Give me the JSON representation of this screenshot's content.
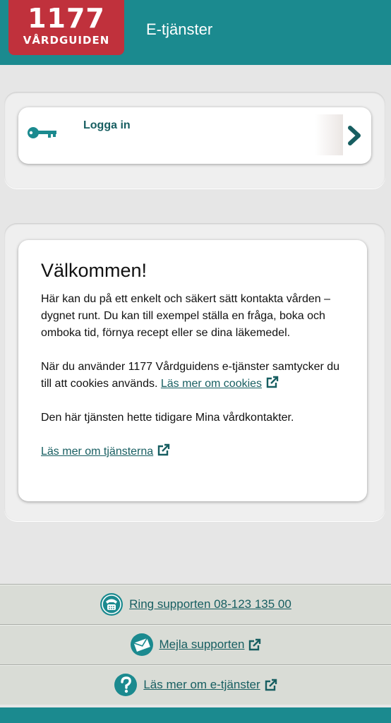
{
  "header": {
    "logo_number": "1177",
    "logo_name": "VÅRDGUIDEN",
    "title": "E-tjänster"
  },
  "login": {
    "label": "Logga in",
    "icon": "key-icon",
    "arrow_icon": "chevron-right-icon"
  },
  "welcome": {
    "title": "Välkommen!",
    "p1": "Här kan du på ett enkelt och säkert sätt kontakta vården – dygnet runt. Du kan till exempel ställa en fråga, boka och omboka tid, förnya recept eller se dina läkemedel.",
    "p2_text": "När du använder 1177 Vårdguidens e-tjänster samtycker du till att cookies används.",
    "p2_link": "Läs mer om cookies",
    "p3": "Den här tjänsten hette tidigare Mina vårdkontakter.",
    "p4_link": "Läs mer om tjänsterna"
  },
  "footer": {
    "items": [
      {
        "label": "Ring supporten 08-123 135 00",
        "icon": "phone-icon"
      },
      {
        "label": "Mejla supporten",
        "icon": "mail-icon"
      },
      {
        "label": "Läs mer om e-tjänster",
        "icon": "help-icon"
      }
    ]
  },
  "colors": {
    "brand_teal": "#1b8a8f",
    "logo_red": "#c0313c",
    "link": "#175e61",
    "background": "#e6e6e6"
  }
}
